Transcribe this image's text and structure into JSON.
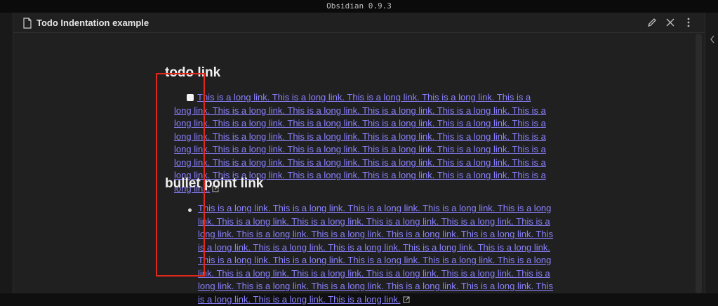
{
  "app": {
    "title": "Obsidian 0.9.3"
  },
  "pane": {
    "title": "Todo Indentation example",
    "file_icon": "file-icon",
    "actions": [
      {
        "name": "edit-icon"
      },
      {
        "name": "close-icon"
      },
      {
        "name": "more-options-icon"
      }
    ]
  },
  "sidebar": {
    "collapse_icon": "chevron-left-icon"
  },
  "note": {
    "todo_heading": "todo link",
    "todo_item": {
      "checked": false,
      "link_text": "This is a long link. This is a long link. This is a long link. This is a long link. This is a long link. This is a long link. This is a long link. This is a long link. This is a long link. This is a long link. This is a long link. This is a long link. This is a long link. This is a long link. This is a long link. This is a long link. This is a long link. This is a long link. This is a long link. This is a long link. This is a long link. This is a long link. This is a long link. This is a long link. This is a long link. This is a long link. This is a long link. This is a long link. This is a long link. This is a long link. This is a long link. This is a long link. This is a long link. This is a long link. This is a long link."
    },
    "bullet_heading": "bullet point link",
    "bullet_item": {
      "link_text": "This is a long link. This is a long link. This is a long link. This is a long link. This is a long link. This is a long link. This is a long link. This is a long link. This is a long link. This is a long link. This is a long link. This is a long link. This is a long link. This is a long link. This is a long link. This is a long link. This is a long link. This is a long link. This is a long link. This is a long link. This is a long link. This is a long link. This is a long link. This is a long link. This is a long link. This is a long link. This is a long link. This is a long link. This is a long link. This is a long link. This is a long link. This is a long link. This is a long link. This is a long link. This is a long link. This is a long link."
    }
  },
  "colors": {
    "link": "#8a82ff",
    "background": "#202020",
    "highlight": "#e0281b"
  }
}
